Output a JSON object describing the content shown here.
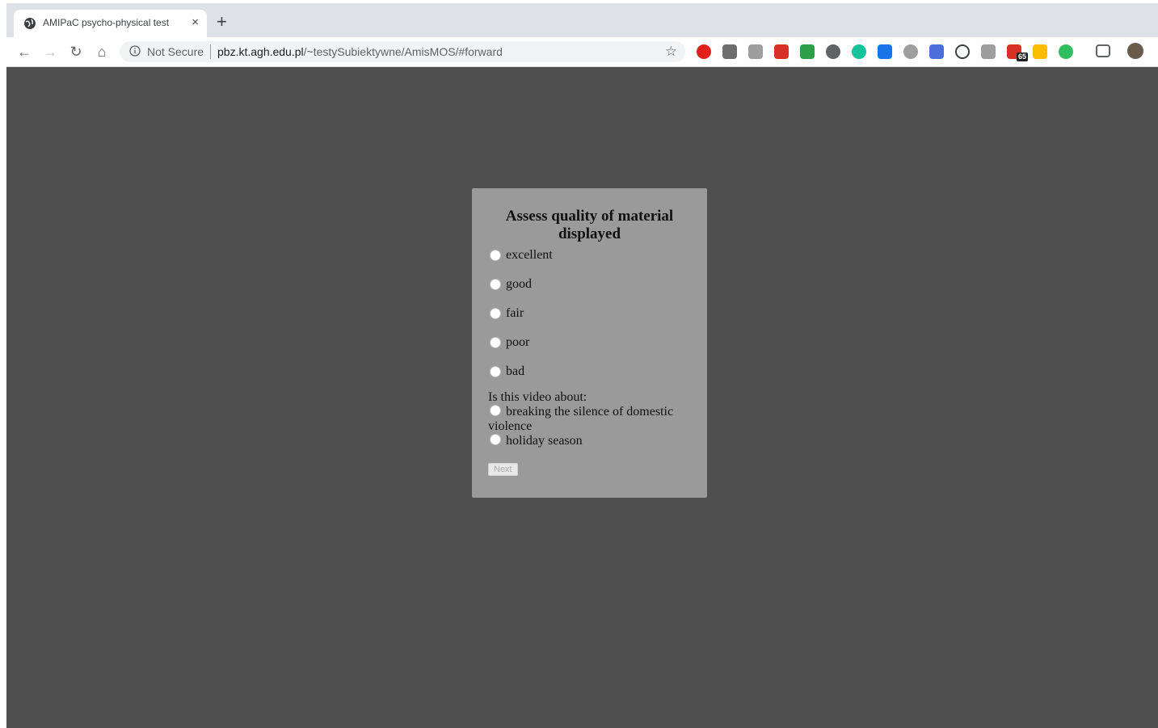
{
  "browser": {
    "tab_title": "AMIPaC psycho-physical test",
    "tab_close": "×",
    "new_tab": "+",
    "security_label": "Not Secure",
    "url_host": "pbz.kt.agh.edu.pl",
    "url_path": "/~testySubiektywne/AmisMOS/#forward",
    "extension_badge": "65"
  },
  "form": {
    "title": "Assess quality of material displayed",
    "ratings": [
      "excellent",
      "good",
      "fair",
      "poor",
      "bad"
    ],
    "topic_question": "Is this video about:",
    "topics": [
      "breaking the silence of domestic violence",
      "holiday season"
    ],
    "next_label": "Next"
  }
}
